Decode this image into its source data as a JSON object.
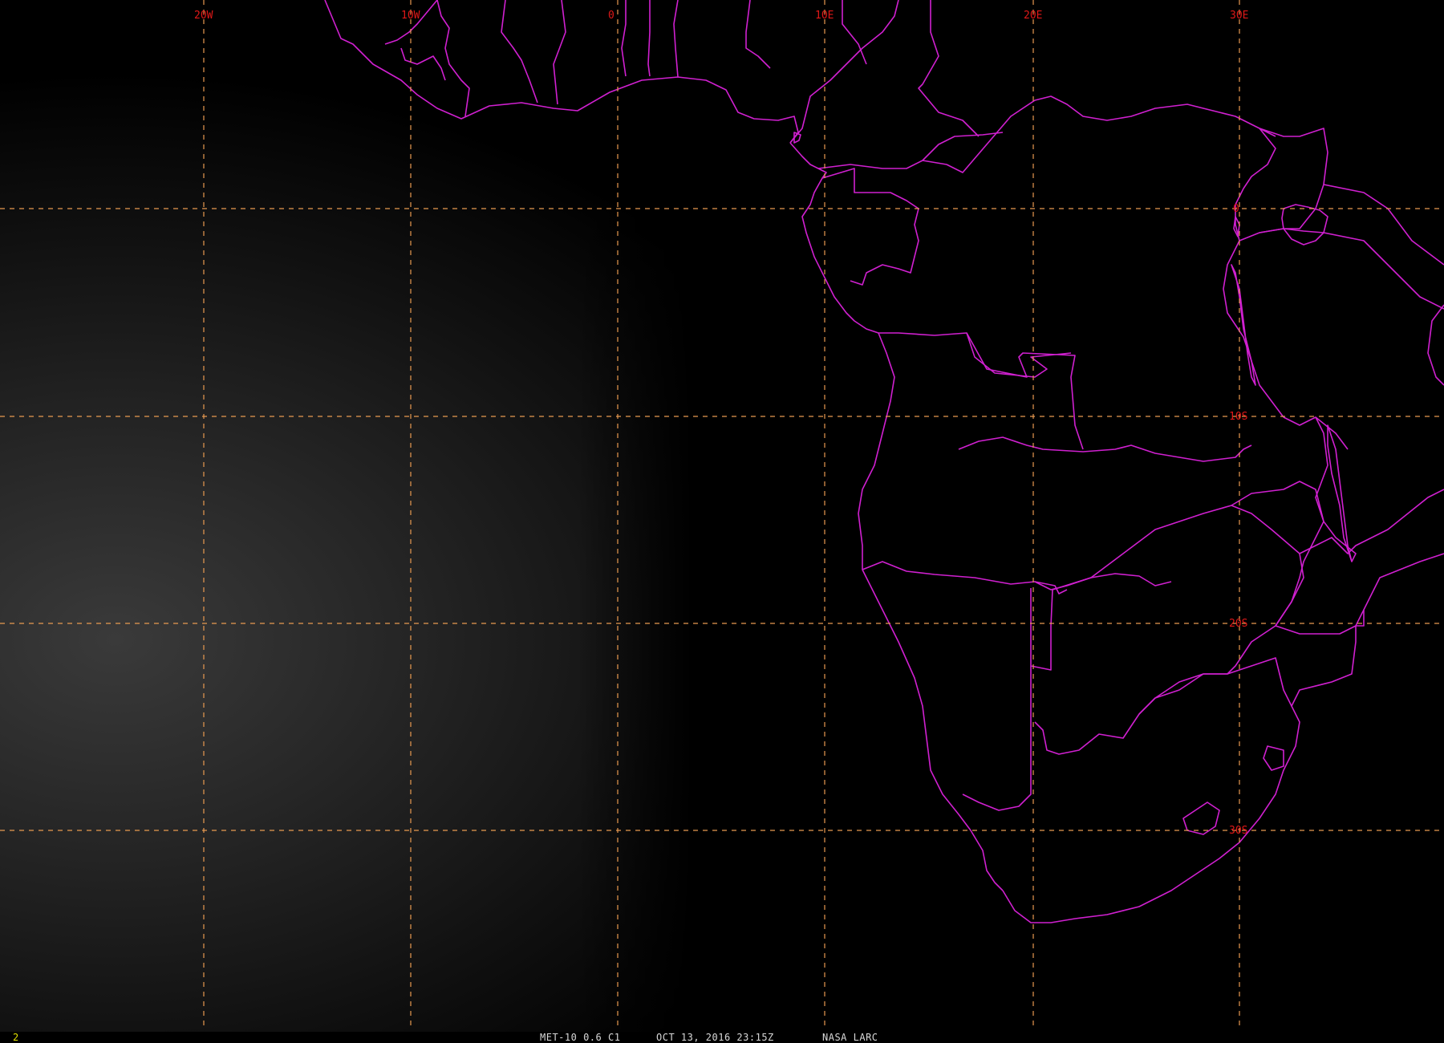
{
  "map": {
    "grid_color": "#e89a50",
    "label_color": "#e01818",
    "boundary_color": "#d020d0",
    "background": "#000000",
    "longitude_labels": [
      "20W",
      "10W",
      "0",
      "10E",
      "20E",
      "30E"
    ],
    "latitude_labels": [
      "0",
      "10S",
      "20S",
      "30S"
    ]
  },
  "status": {
    "frame": "2",
    "satellite": "MET-10 0.6 C1",
    "datetime": "OCT 13, 2016 23:15Z",
    "agency": "NASA LARC"
  }
}
